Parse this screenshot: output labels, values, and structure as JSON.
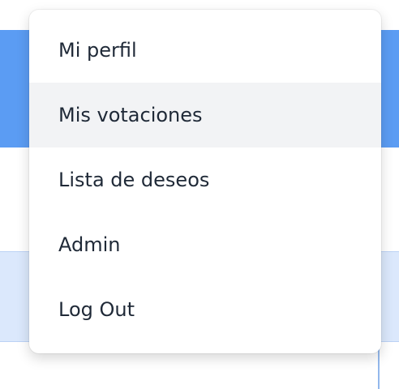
{
  "menu": {
    "items": [
      {
        "label": "Mi perfil"
      },
      {
        "label": "Mis votaciones"
      },
      {
        "label": "Lista de deseos"
      },
      {
        "label": "Admin"
      },
      {
        "label": "Log Out"
      }
    ]
  },
  "colors": {
    "header_blue": "#5b9cf3",
    "panel_blue": "#dbe8fc",
    "hover_gray": "#f2f3f5",
    "text": "#1f2937"
  }
}
